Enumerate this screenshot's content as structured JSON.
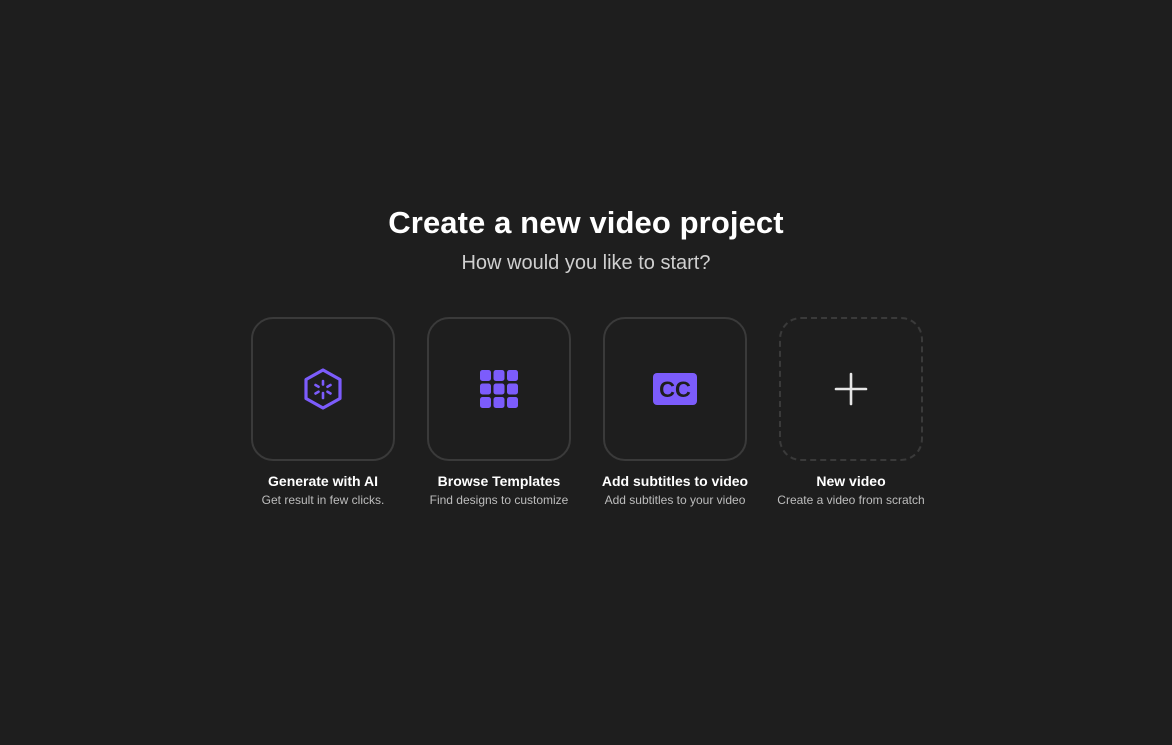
{
  "header": {
    "title": "Create a new video project",
    "subtitle": "How would you like to start?"
  },
  "accent_color": "#7c5cfc",
  "options": [
    {
      "icon": "ai-hexagon-icon",
      "label": "Generate with AI",
      "description": "Get result in few clicks."
    },
    {
      "icon": "grid-icon",
      "label": "Browse Templates",
      "description": "Find designs to customize"
    },
    {
      "icon": "closed-captions-icon",
      "icon_text": "CC",
      "label": "Add subtitles to video",
      "description": "Add subtitles to your video"
    },
    {
      "icon": "plus-icon",
      "label": "New video",
      "description": "Create a video from scratch"
    }
  ]
}
